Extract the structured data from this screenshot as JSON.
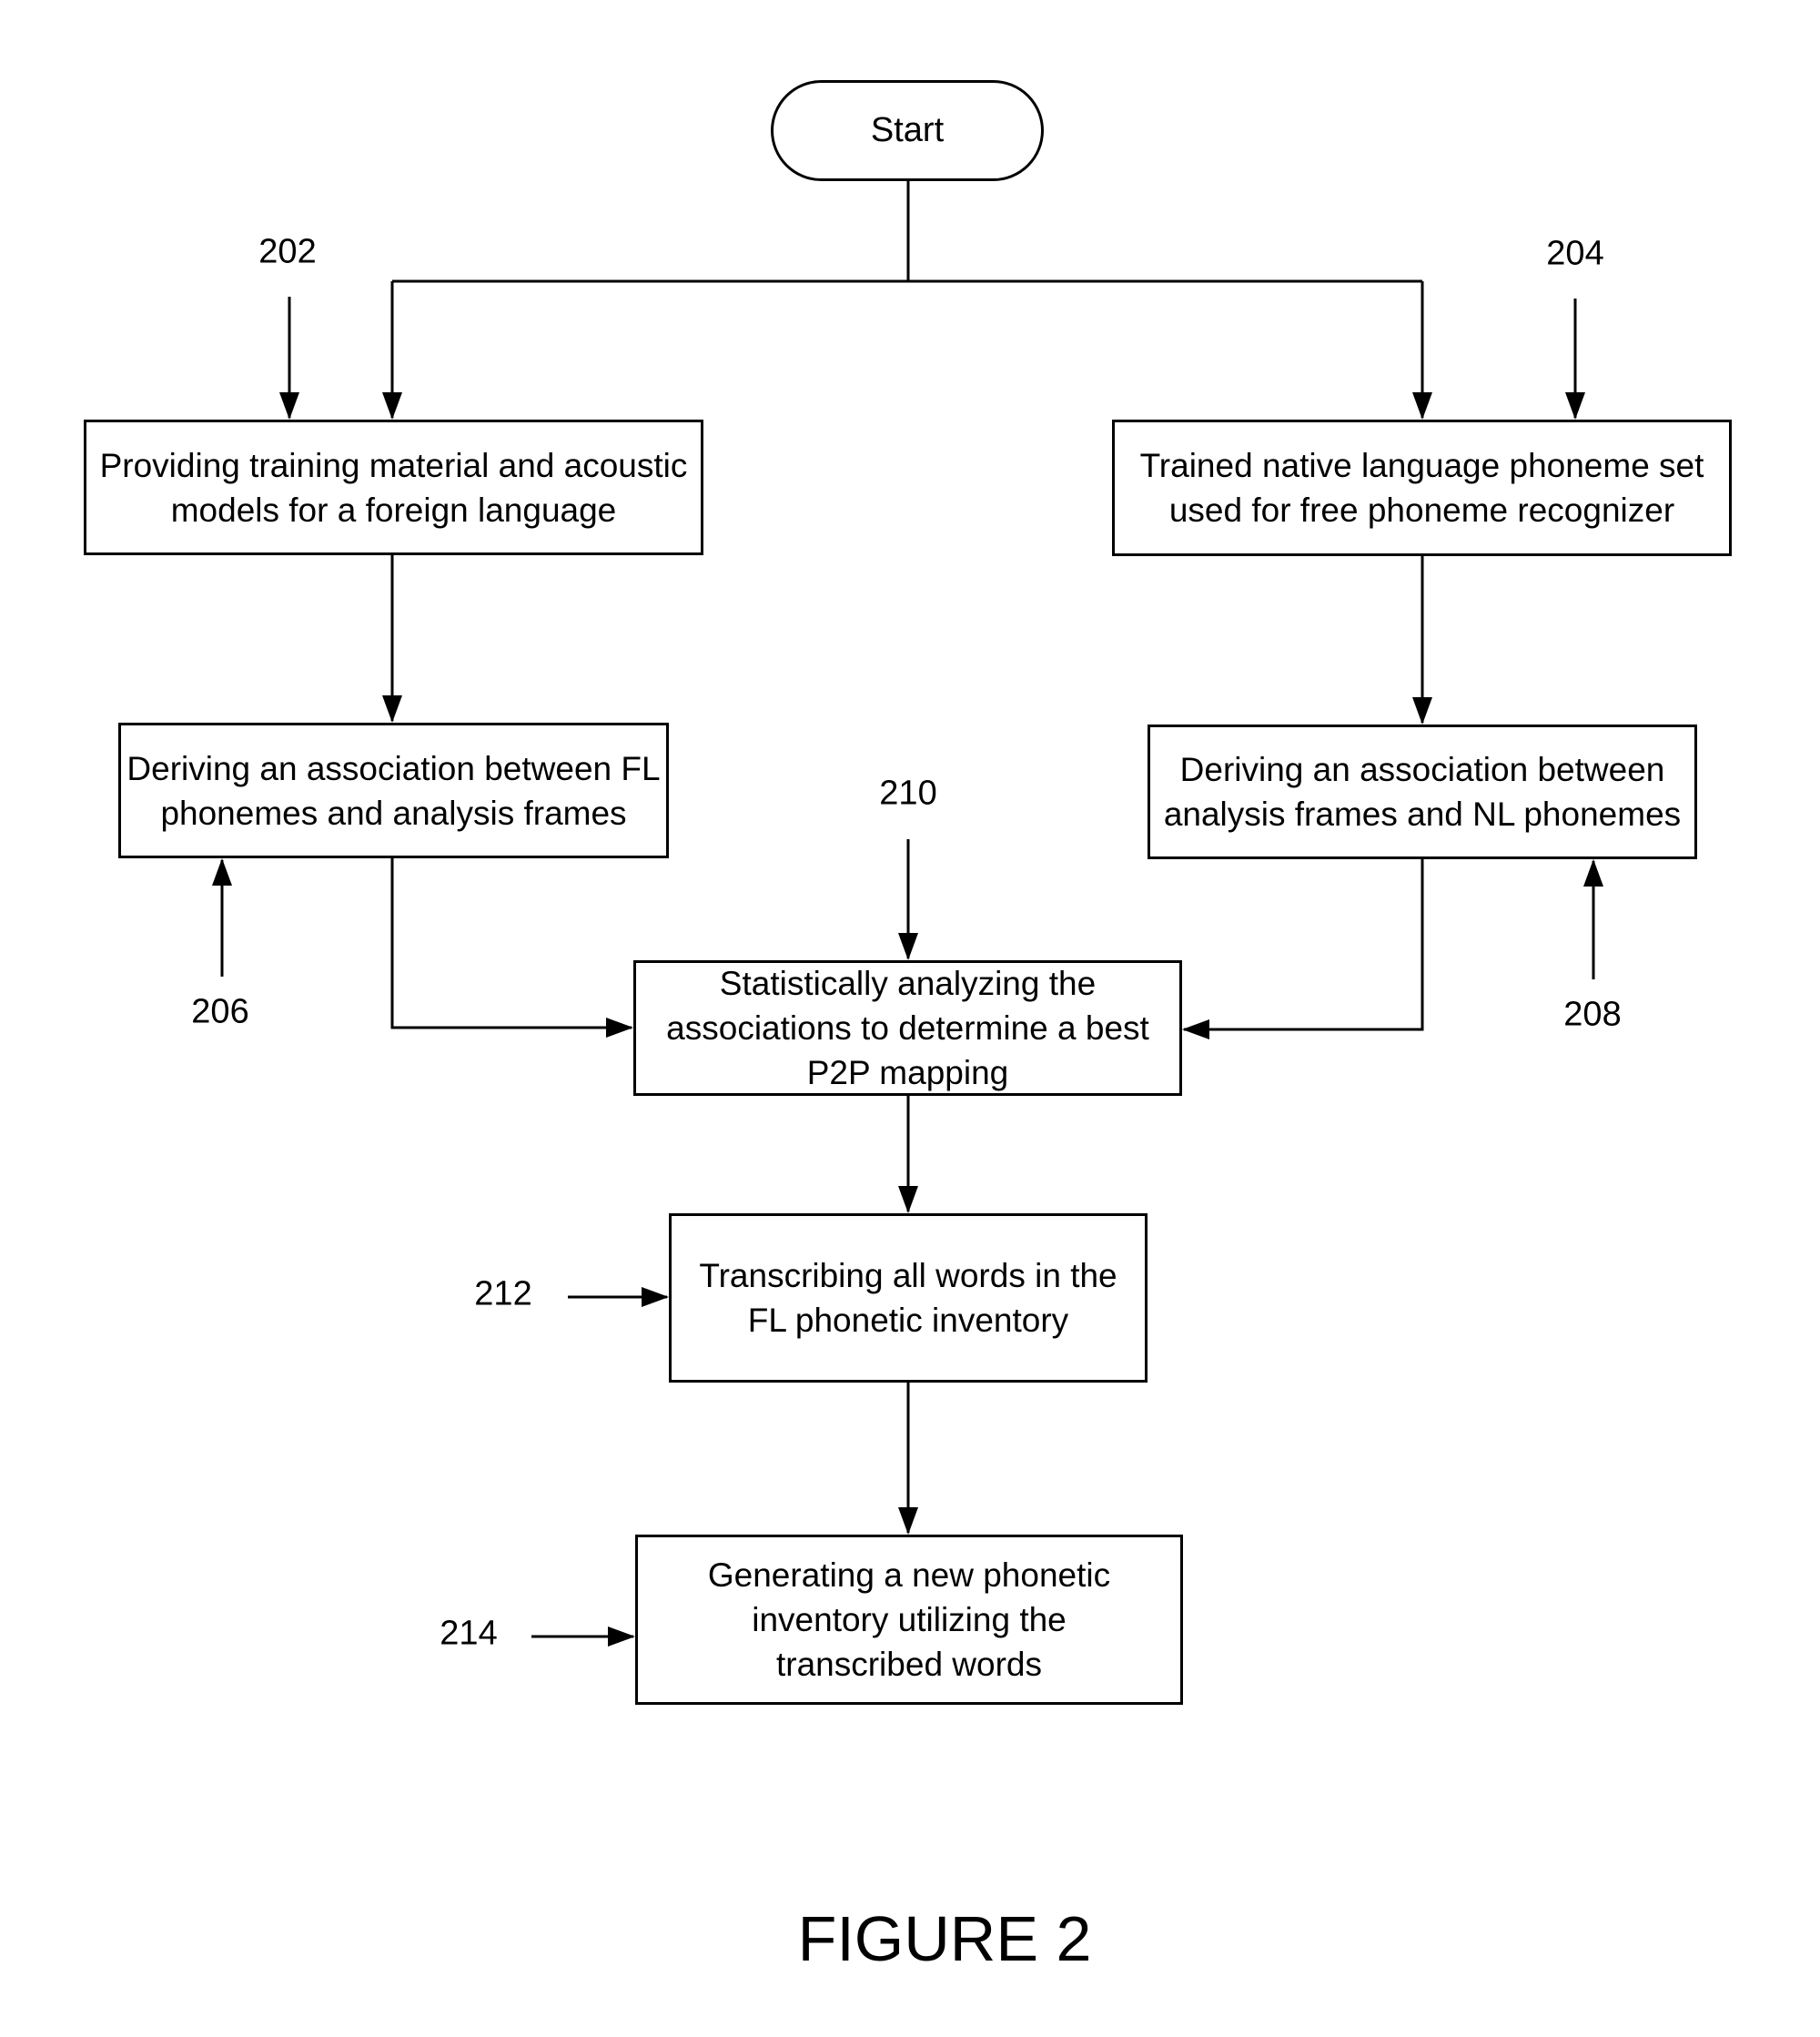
{
  "diagram": {
    "type": "flowchart",
    "start": {
      "label": "Start"
    },
    "steps": [
      {
        "id": "202",
        "text": "Providing training material and acoustic models for a foreign language"
      },
      {
        "id": "204",
        "text": "Trained native language phoneme set used for free phoneme recognizer"
      },
      {
        "id": "206",
        "text": "Deriving an association between FL phonemes and analysis frames"
      },
      {
        "id": "208",
        "text": "Deriving an association between analysis frames and NL phonemes"
      },
      {
        "id": "210",
        "text": "Statistically analyzing the associations to determine a best P2P mapping"
      },
      {
        "id": "212",
        "text": "Transcribing all words in the FL phonetic inventory"
      },
      {
        "id": "214",
        "text": "Generating a new phonetic inventory utilizing the transcribed words"
      }
    ],
    "refs": {
      "r202": "202",
      "r204": "204",
      "r206": "206",
      "r208": "208",
      "r210": "210",
      "r212": "212",
      "r214": "214"
    },
    "edges": [
      {
        "from": "Start",
        "to": "202"
      },
      {
        "from": "Start",
        "to": "204"
      },
      {
        "from": "202",
        "to": "206"
      },
      {
        "from": "204",
        "to": "208"
      },
      {
        "from": "206",
        "to": "210"
      },
      {
        "from": "208",
        "to": "210"
      },
      {
        "from": "210",
        "to": "212"
      },
      {
        "from": "212",
        "to": "214"
      }
    ],
    "caption": "FIGURE 2"
  }
}
